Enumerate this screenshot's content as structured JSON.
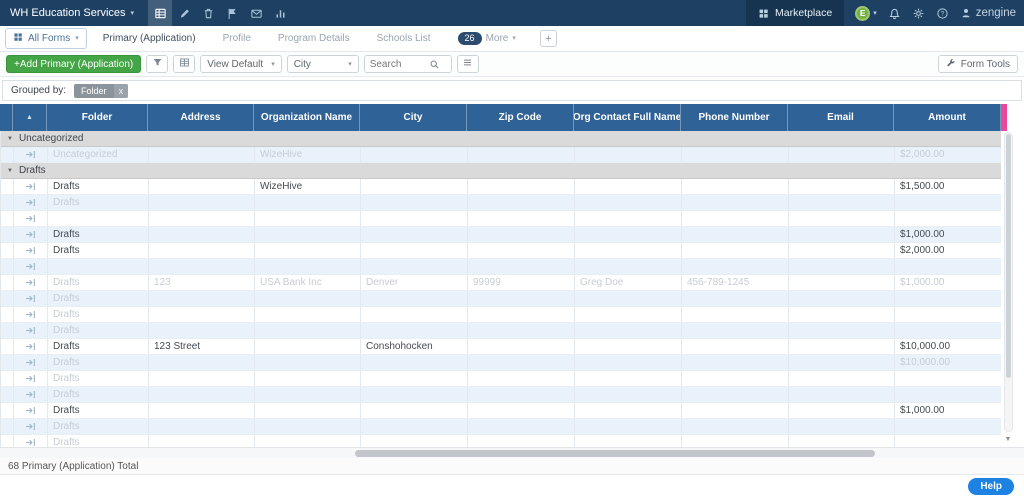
{
  "navbar": {
    "workspace": "WH Education Services",
    "nav_icons": [
      {
        "name": "data-grid-icon",
        "active": true
      },
      {
        "name": "edit-icon",
        "active": false
      },
      {
        "name": "trash-icon",
        "active": false
      },
      {
        "name": "flag-icon",
        "active": false
      },
      {
        "name": "mail-icon",
        "active": false
      },
      {
        "name": "reports-icon",
        "active": false
      }
    ],
    "marketplace_label": "Marketplace",
    "avatar_initial": "E",
    "brand": "zengine"
  },
  "tabs": {
    "all_forms_label": "All Forms",
    "items": [
      {
        "label": "Primary (Application)",
        "active": true
      },
      {
        "label": "Profile",
        "active": false
      },
      {
        "label": "Program Details",
        "active": false
      },
      {
        "label": "Schools List",
        "active": false
      }
    ],
    "more_count": "26",
    "more_label": "More",
    "add_label": "+"
  },
  "toolbar": {
    "add_label": "+Add Primary (Application)",
    "view_select": "View Default",
    "field_select": "City",
    "search_placeholder": "Search",
    "form_tools_label": "Form Tools"
  },
  "grouping": {
    "label": "Grouped by:",
    "chip_label": "Folder",
    "chip_remove": "x"
  },
  "grid": {
    "columns": [
      "Folder",
      "Address",
      "Organization Name",
      "City",
      "Zip Code",
      "Org Contact Full Name",
      "Phone Number",
      "Email",
      "Amount"
    ],
    "groups": [
      {
        "name": "Uncategorized",
        "rows": [
          {
            "cells": [
              "Uncategorized",
              "",
              "WizeHive",
              "",
              "",
              "",
              "",
              "",
              "$2,000.00"
            ],
            "muted": true
          }
        ]
      },
      {
        "name": "Drafts",
        "rows": [
          {
            "cells": [
              "Drafts",
              "",
              "WizeHive",
              "",
              "",
              "",
              "",
              "",
              "$1,500.00"
            ],
            "muted": false
          },
          {
            "cells": [
              "Drafts",
              "",
              "",
              "",
              "",
              "",
              "",
              "",
              ""
            ],
            "muted": true
          },
          {
            "cells": [
              "",
              "",
              "",
              "",
              "",
              "",
              "",
              "",
              ""
            ],
            "muted": true
          },
          {
            "cells": [
              "Drafts",
              "",
              "",
              "",
              "",
              "",
              "",
              "",
              "$1,000.00"
            ],
            "muted": false
          },
          {
            "cells": [
              "Drafts",
              "",
              "",
              "",
              "",
              "",
              "",
              "",
              "$2,000.00"
            ],
            "muted": false
          },
          {
            "cells": [
              "",
              "",
              "",
              "",
              "",
              "",
              "",
              "",
              ""
            ],
            "muted": true
          },
          {
            "cells": [
              "Drafts",
              "123",
              "USA Bank Inc",
              "Denver",
              "99999",
              "Greg Doe",
              "456-789-1245",
              "",
              "$1,000.00"
            ],
            "muted": true
          },
          {
            "cells": [
              "Drafts",
              "",
              "",
              "",
              "",
              "",
              "",
              "",
              ""
            ],
            "muted": true
          },
          {
            "cells": [
              "Drafts",
              "",
              "",
              "",
              "",
              "",
              "",
              "",
              ""
            ],
            "muted": true
          },
          {
            "cells": [
              "Drafts",
              "",
              "",
              "",
              "",
              "",
              "",
              "",
              ""
            ],
            "muted": true
          },
          {
            "cells": [
              "Drafts",
              "123 Street",
              "",
              "Conshohocken",
              "",
              "",
              "",
              "",
              "$10,000.00"
            ],
            "muted": false
          },
          {
            "cells": [
              "Drafts",
              "",
              "",
              "",
              "",
              "",
              "",
              "",
              "$10,000.00"
            ],
            "muted": true
          },
          {
            "cells": [
              "Drafts",
              "",
              "",
              "",
              "",
              "",
              "",
              "",
              ""
            ],
            "muted": true
          },
          {
            "cells": [
              "Drafts",
              "",
              "",
              "",
              "",
              "",
              "",
              "",
              ""
            ],
            "muted": true
          },
          {
            "cells": [
              "Drafts",
              "",
              "",
              "",
              "",
              "",
              "",
              "",
              "$1,000.00"
            ],
            "muted": false
          },
          {
            "cells": [
              "Drafts",
              "",
              "",
              "",
              "",
              "",
              "",
              "",
              ""
            ],
            "muted": true
          },
          {
            "cells": [
              "Drafts",
              "",
              "",
              "",
              "",
              "",
              "",
              "",
              ""
            ],
            "muted": true
          }
        ]
      }
    ]
  },
  "status": {
    "total_label": "68 Primary (Application) Total"
  },
  "help": {
    "label": "Help"
  }
}
